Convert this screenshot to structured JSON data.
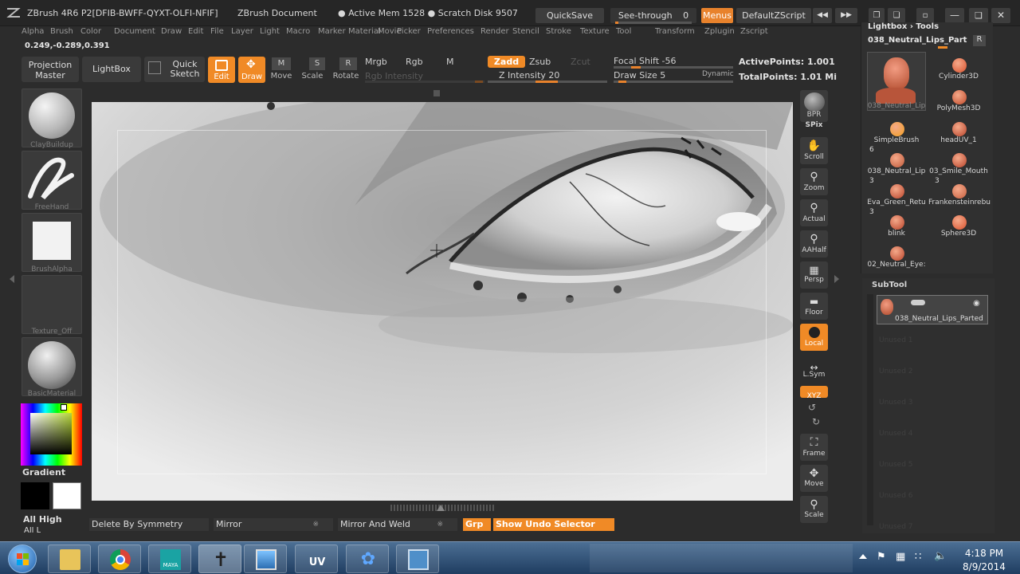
{
  "titlebar": {
    "app_title": "ZBrush 4R6 P2[DFIB-BWFF-QYXT-OLFI-NFIF]",
    "document": "ZBrush Document",
    "active_mem": "● Active Mem 1528 ● Scratch Disk 9507",
    "quicksave": "QuickSave",
    "see_through_label": "See-through",
    "see_through_value": "0",
    "menus": "Menus",
    "zscript": "DefaultZScript"
  },
  "menu": [
    "Alpha",
    "Brush",
    "Color",
    "Document",
    "Draw",
    "Edit",
    "File",
    "Layer",
    "Light",
    "Macro",
    "Marker",
    "Material",
    "Movie",
    "Picker",
    "Preferences",
    "Render",
    "Stencil",
    "Stroke",
    "Texture",
    "Tool",
    "Transform",
    "Zplugin",
    "Zscript"
  ],
  "coords": "0.249,-0.289,0.391",
  "toolbar": {
    "projection_master": "Projection Master",
    "lightbox": "LightBox",
    "quick_sketch": "Quick Sketch",
    "edit": "Edit",
    "draw": "Draw",
    "move": "Move",
    "scale": "Scale",
    "rotate": "Rotate",
    "mrgb": "Mrgb",
    "rgb": "Rgb",
    "m": "M",
    "rgb_intensity": "Rgb Intensity",
    "zadd": "Zadd",
    "zsub": "Zsub",
    "zcut": "Zcut",
    "z_intensity": "Z Intensity 20",
    "focal_shift": "Focal Shift -56",
    "draw_size": "Draw Size 5",
    "dynamic": "Dynamic",
    "active_points": "ActivePoints: 1.001",
    "total_points": "TotalPoints: 1.01 Mi"
  },
  "left_shelf": {
    "brush": "ClayBuildup",
    "stroke": "FreeHand",
    "alpha": "BrushAlpha",
    "texture": "Texture_Off",
    "material": "BasicMaterial",
    "gradient": "Gradient",
    "all_high": "All High",
    "all_low": "All L"
  },
  "right_shelf": [
    "BPR",
    "SPix",
    "Scroll",
    "Zoom",
    "Actual",
    "AAHalf",
    "Persp",
    "Floor",
    "Local",
    "L.Sym",
    "XYZ",
    "Frame",
    "Move",
    "Scale"
  ],
  "right_panel": {
    "header": "Lightbox › Tools",
    "current_tool": "038_Neutral_Lips_Part",
    "r_button": "R",
    "tools": [
      {
        "label": "038_Neutral_Lip",
        "num": ""
      },
      {
        "label": "Cylinder3D",
        "num": ""
      },
      {
        "label": "PolyMesh3D",
        "num": ""
      },
      {
        "label": "SimpleBrush",
        "num": "6"
      },
      {
        "label": "headUV_1",
        "num": ""
      },
      {
        "label": "038_Neutral_Lip",
        "num": "3"
      },
      {
        "label": "03_Smile_Mouth",
        "num": "3"
      },
      {
        "label": "Eva_Green_Retu",
        "num": "3"
      },
      {
        "label": "Frankensteinrebu",
        "num": ""
      },
      {
        "label": "blink",
        "num": ""
      },
      {
        "label": "Sphere3D",
        "num": ""
      },
      {
        "label": "02_Neutral_Eye:",
        "num": ""
      }
    ],
    "subtool_header": "SubTool",
    "subtool_item": "038_Neutral_Lips_Parted",
    "subtool_empty": [
      "Unused 1",
      "Unused 2",
      "Unused 3",
      "Unused 4",
      "Unused 5",
      "Unused 6",
      "Unused 7"
    ]
  },
  "bottom": {
    "delete_by_symmetry": "Delete By Symmetry",
    "mirror": "Mirror",
    "mirror_and_weld": "Mirror And Weld",
    "grp": "Grp",
    "show_undo": "Show Undo Selector"
  },
  "taskbar": {
    "apps": [
      "Windows Explorer",
      "Google Chrome",
      "Maya",
      "ZBrush",
      "Image Viewer",
      "UV Layout",
      "Application",
      "Network"
    ],
    "time": "4:18 PM",
    "date": "8/9/2014"
  },
  "colors": {
    "accent": "#f08a26",
    "panel": "#303030",
    "background": "#2c2c2c"
  }
}
